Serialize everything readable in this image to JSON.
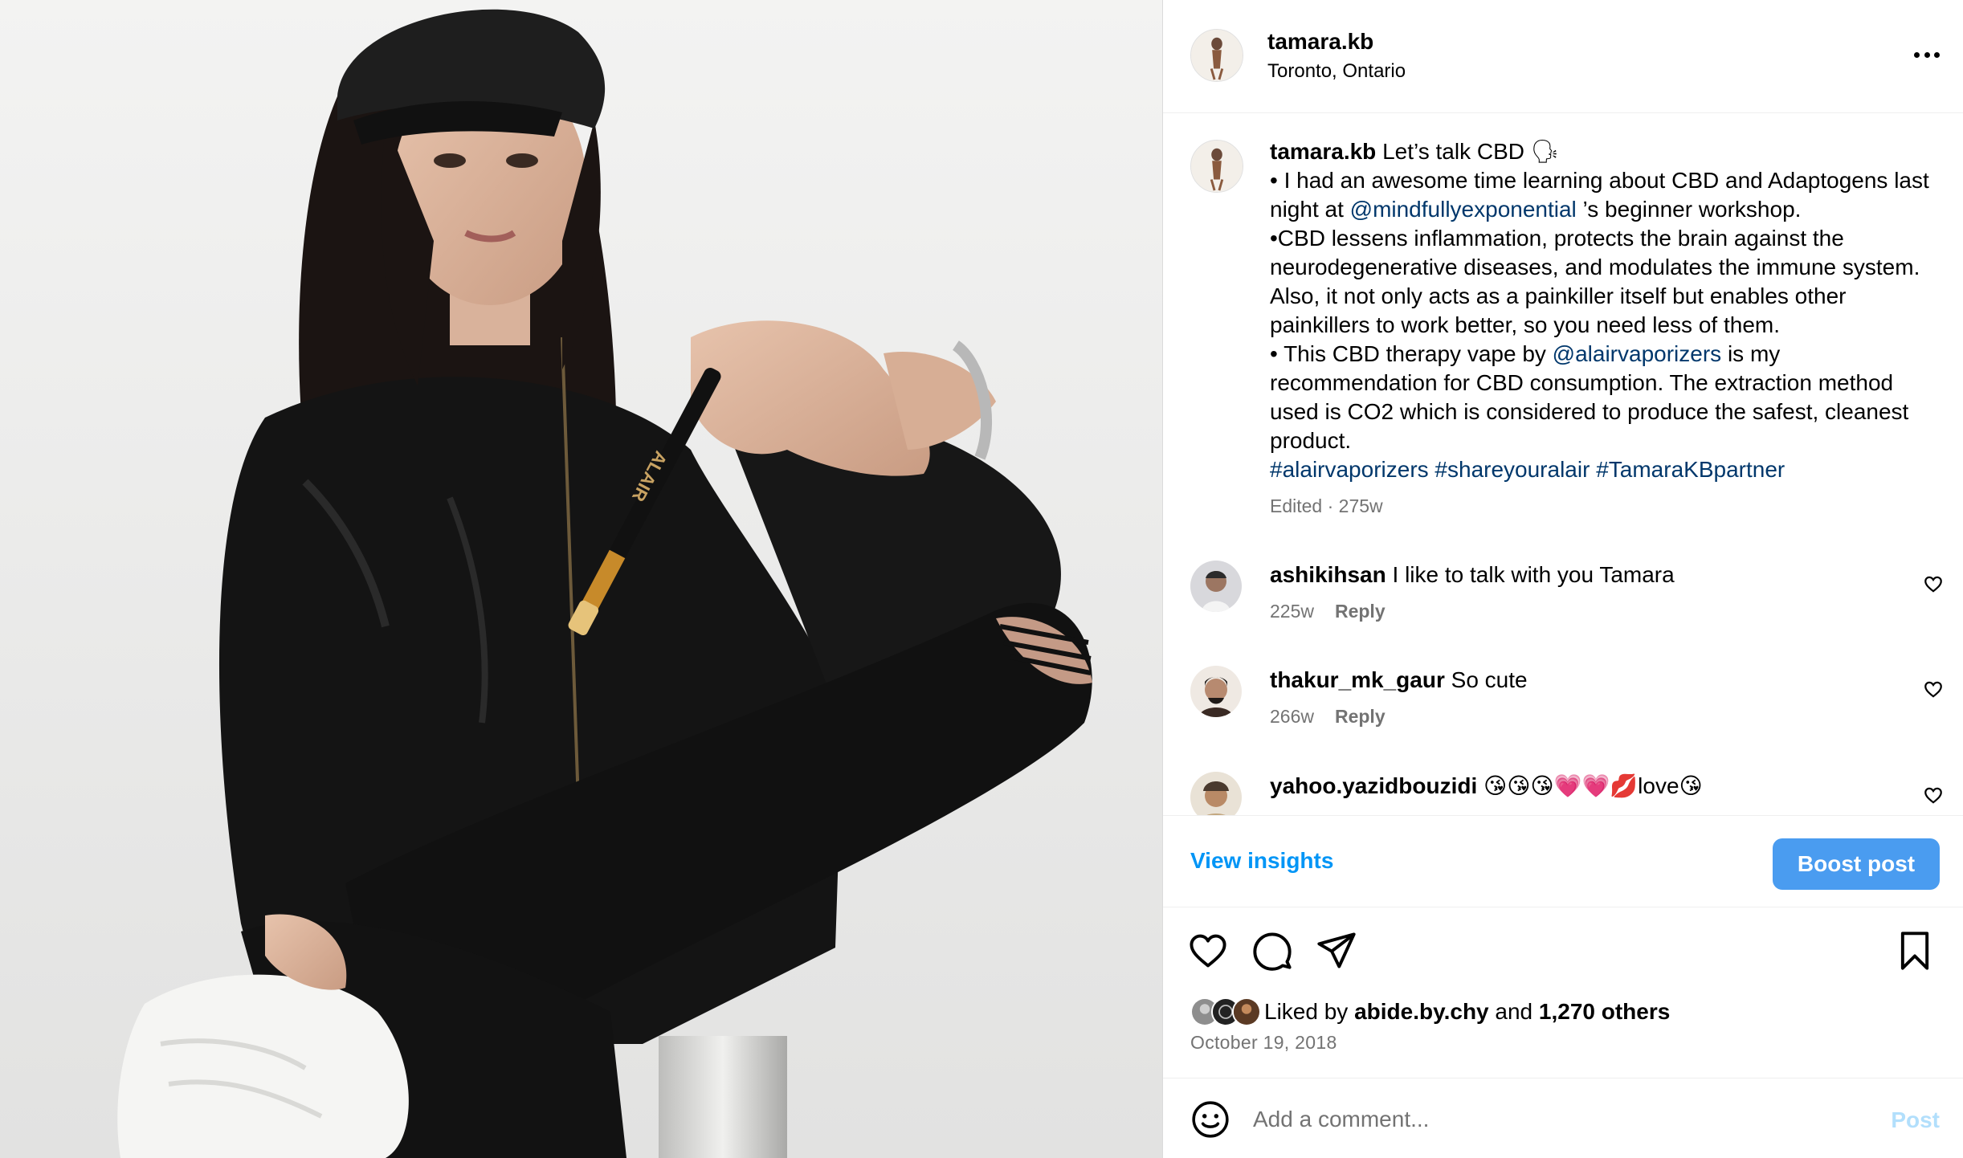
{
  "colors": {
    "link": "#00376b",
    "brand_blue": "#0095f6",
    "boost_button": "#4a9cf0",
    "post_disabled": "#b2dffc",
    "meta_gray": "#737373"
  },
  "post": {
    "image_alt": "Woman in black cap and fleece jacket holding a vape pen",
    "vape_brand_text": "ALAIR"
  },
  "header": {
    "username": "tamara.kb",
    "location": "Toronto, Ontario",
    "more_icon": "more-horizontal-icon"
  },
  "caption": {
    "username": "tamara.kb",
    "intro": " Let’s talk CBD 🗣",
    "p1_a": "• I had an awesome time learning about CBD and Adaptogens last night at ",
    "p1_mention": "@mindfullyexponential",
    "p1_b": " ’s beginner workshop.",
    "p2": "•CBD lessens inflammation, protects the brain against the neurodegenerative diseases, and modulates the immune system. Also, it not only acts as a painkiller itself but enables other painkillers to work better, so you need less of them.",
    "p3_a": "• This CBD therapy vape by ",
    "p3_mention": "@alairvaporizers",
    "p3_b": " is my recommendation for CBD consumption. The extraction method used is CO2 which is considered to produce the safest, cleanest product.",
    "hashtag1": "#alairvaporizers",
    "hashtag2": "#shareyouralair",
    "hashtag3": "#TamaraKBpartner",
    "meta": "Edited · 275w"
  },
  "comments": [
    {
      "username": "ashikihsan",
      "text": " I like to talk with you Tamara",
      "age": "225w",
      "reply": "Reply"
    },
    {
      "username": "thakur_mk_gaur",
      "text": " So cute",
      "age": "266w",
      "reply": "Reply"
    },
    {
      "username": "yahoo.yazidbouzidi",
      "text": " 😘😘😘💗💗💋love😘",
      "age": "",
      "reply": ""
    }
  ],
  "insights": {
    "view_label": "View insights",
    "boost_label": "Boost post"
  },
  "actions": {
    "like_icon": "heart-icon",
    "comment_icon": "comment-icon",
    "share_icon": "send-icon",
    "save_icon": "bookmark-icon"
  },
  "likes": {
    "prefix": "Liked by ",
    "user": "abide.by.chy",
    "middle": " and ",
    "count": "1,270 others"
  },
  "date": "October 19, 2018",
  "comment_box": {
    "placeholder": "Add a comment...",
    "post_label": "Post",
    "emoji_icon": "emoji-icon"
  }
}
